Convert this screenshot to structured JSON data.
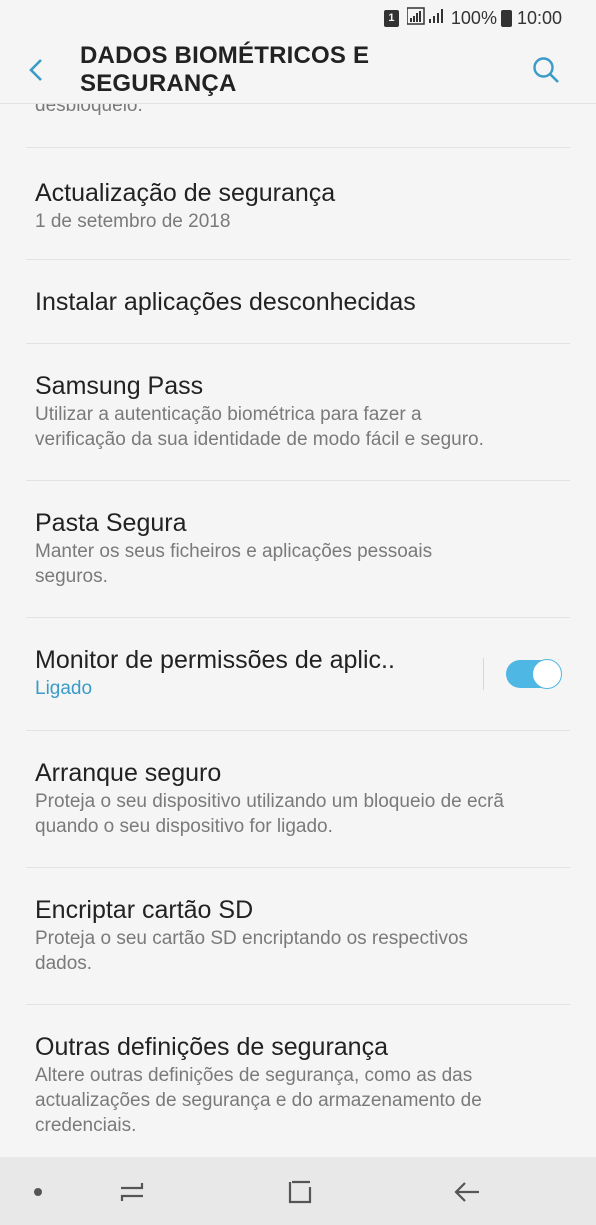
{
  "status_bar": {
    "sim_label": "1",
    "battery": "100%",
    "time": "10:00"
  },
  "header": {
    "title": "DADOS BIOMÉTRICOS E SEGURANÇA",
    "back_icon": "chevron-left-icon",
    "search_icon": "search-icon"
  },
  "partial_item": {
    "subtitle_fragment": "desbloqueio."
  },
  "items": [
    {
      "title": "Actualização de segurança",
      "subtitle": "1 de setembro de 2018"
    },
    {
      "title": "Instalar aplicações desconhecidas"
    },
    {
      "title": "Samsung Pass",
      "subtitle_lines": [
        "Utilizar a autenticação biométrica para fazer a",
        "verificação da sua identidade de modo fácil e seguro."
      ]
    },
    {
      "title": "Pasta Segura",
      "subtitle_lines": [
        "Manter os seus ficheiros e aplicações pessoais",
        "seguros."
      ]
    },
    {
      "title": "Monitor de permissões de aplic..",
      "subtitle": "Ligado",
      "toggle_on": true
    },
    {
      "title": "Arranque seguro",
      "subtitle_lines": [
        "Proteja o seu dispositivo utilizando um bloqueio de ecrã",
        "quando o seu dispositivo for ligado."
      ]
    },
    {
      "title": "Encriptar cartão SD",
      "subtitle_lines": [
        "Proteja o seu cartão SD encriptando os respectivos",
        "dados."
      ]
    },
    {
      "title": "Outras definições de segurança",
      "subtitle_lines": [
        "Altere outras definições de segurança, como as das",
        "actualizações de segurança e do armazenamento de",
        "credenciais."
      ]
    }
  ],
  "colors": {
    "accent": "#3b9bc8",
    "toggle_on": "#4fb7e4",
    "background": "#f5f5f5",
    "nav_bar": "#e8e8e8"
  },
  "nav_bar": {
    "icons": [
      "dot-icon",
      "recent-apps-icon",
      "home-icon",
      "back-arrow-icon"
    ]
  }
}
